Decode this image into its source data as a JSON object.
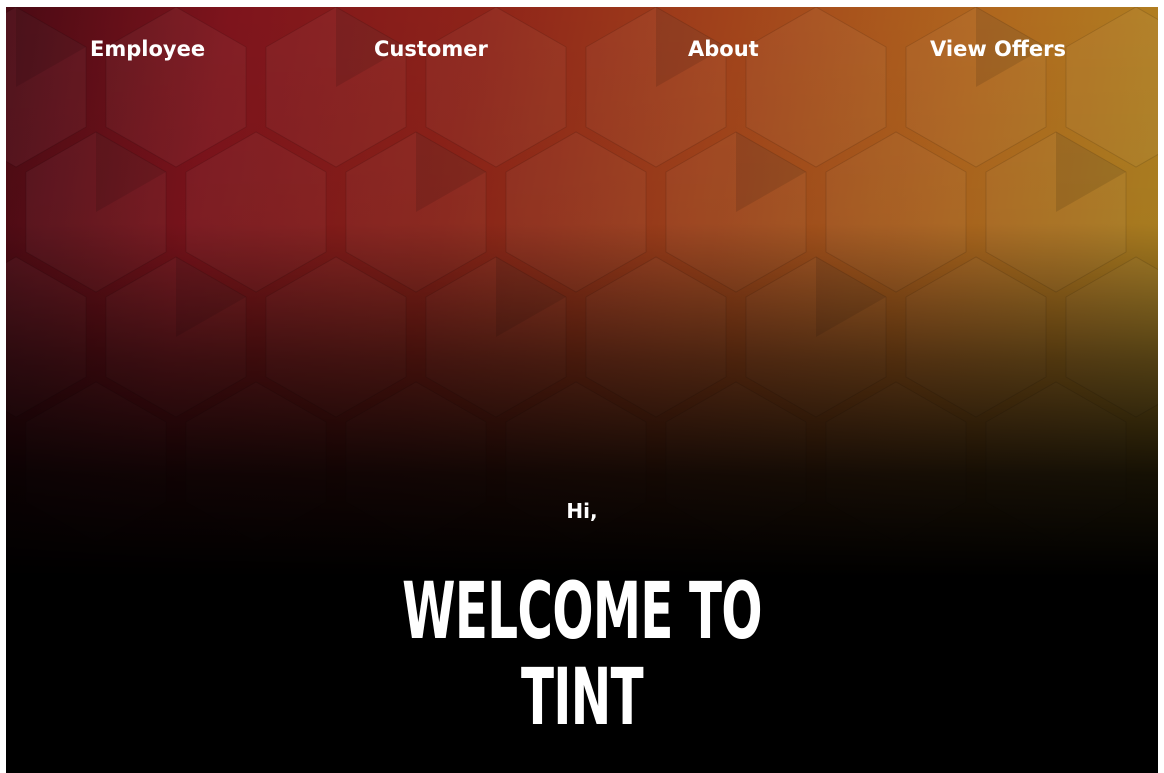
{
  "nav": {
    "employee_label": "Employee",
    "customer_label": "Customer",
    "about_label": "About",
    "offers_label": "View Offers"
  },
  "hero": {
    "greeting": "Hi,",
    "headline_line1": "WELCOME TO",
    "headline_line2": "TINT"
  },
  "colors": {
    "hero_gradient": [
      "#4a0a14",
      "#7e141c",
      "#a2431b",
      "#b08a22"
    ],
    "page_background": "#000000",
    "text": "#ffffff"
  }
}
